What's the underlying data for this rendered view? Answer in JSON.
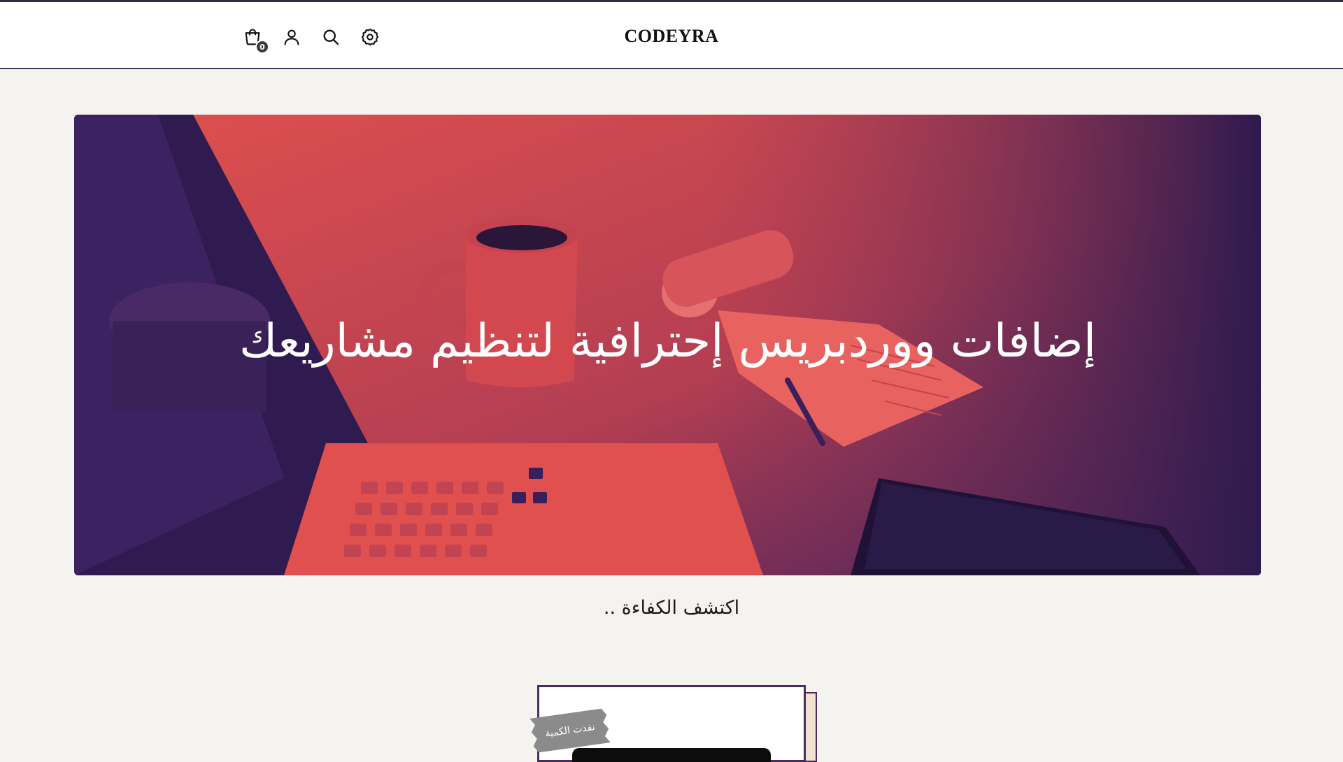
{
  "header": {
    "logo": "CODEYRA",
    "cart_count": "0",
    "icons": [
      "cart-icon",
      "user-icon",
      "search-icon",
      "settings-icon"
    ]
  },
  "hero": {
    "title": "إضافات ووردبريس إحترافية لتنظيم مشاريعك"
  },
  "section": {
    "subtitle": "اكتشف الكفاءة .."
  },
  "product_card": {
    "badge": "نفدت الكمية"
  },
  "colors": {
    "accent_red": "#e0504e",
    "accent_purple": "#3a1f5c",
    "card_border": "#4b2c5e",
    "page_bg": "#f5f3ef"
  }
}
